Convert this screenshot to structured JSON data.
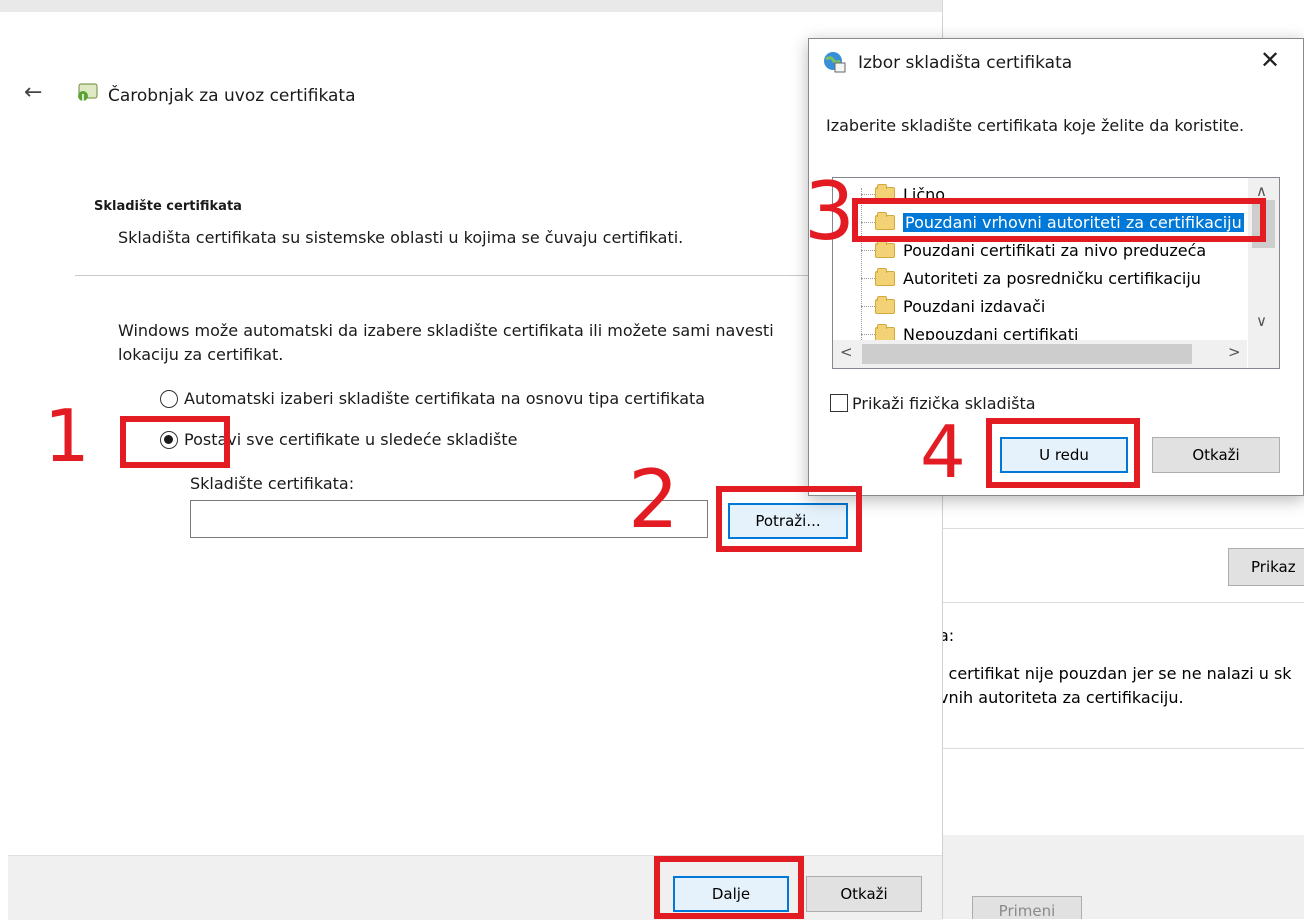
{
  "background": {
    "prikaz_label": "Prikaz",
    "section_label": "a:",
    "info_line1": "i certifikat nije pouzdan jer se ne nalazi u sk",
    "info_line2": "vnih autoriteta za certifikaciju.",
    "apply_label": "Primeni"
  },
  "wizard": {
    "title": "Čarobnjak za uvoz certifikata",
    "section_title": "Skladište certifikata",
    "section_desc": "Skladišta certifikata su sistemske oblasti u kojima se čuvaju certifikati.",
    "intro_line1": "Windows može automatski da izabere skladište certifikata ili možete sami navesti",
    "intro_line2": "lokaciju za certifikat.",
    "radio_auto": "Automatski izaberi skladište certifikata na osnovu tipa certifikata",
    "radio_manual": "Postavi sve certifikate u sledeće skladište",
    "store_label": "Skladište certifikata:",
    "store_value": "",
    "browse_label": "Potraži...",
    "next_label": "Dalje",
    "cancel_label": "Otkaži"
  },
  "store_dialog": {
    "title": "Izbor skladišta certifikata",
    "instruction": "Izaberite skladište certifikata koje želite da koristite.",
    "items": [
      "Lično",
      "Pouzdani vrhovni autoriteti za certifikaciju",
      "Pouzdani certifikati za nivo preduzeća",
      "Autoriteti za posredničku certifikaciju",
      "Pouzdani izdavači",
      "Nepouzdani certifikati"
    ],
    "selected_index": 1,
    "show_physical_label": "Prikaži fizička skladišta",
    "ok_label": "U redu",
    "cancel_label": "Otkaži"
  },
  "annotations": [
    "1",
    "2",
    "3",
    "4"
  ],
  "colors": {
    "annotation": "#e31c23",
    "selection": "#0078d7"
  }
}
